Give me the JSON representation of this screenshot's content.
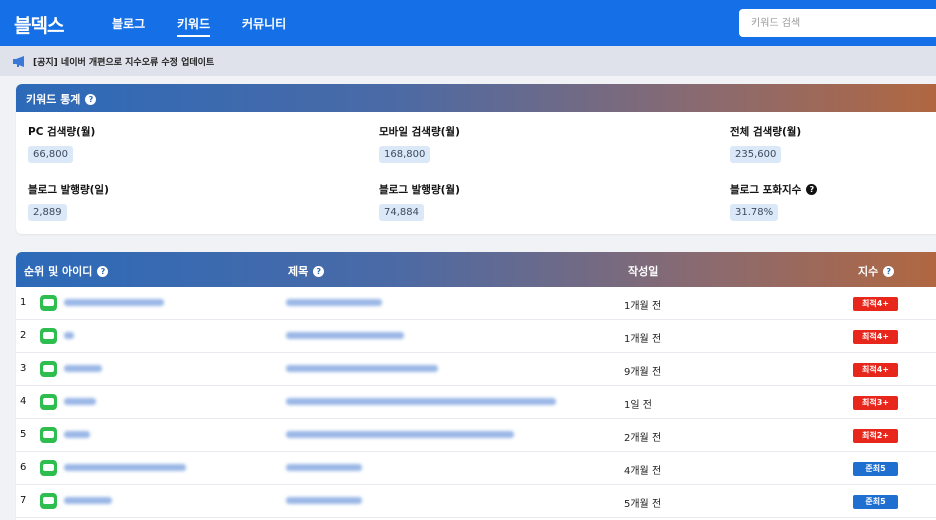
{
  "app": {
    "logo": "블덱스"
  },
  "nav": [
    {
      "label": "블로그"
    },
    {
      "label": "키워드"
    },
    {
      "label": "커뮤니티"
    }
  ],
  "search": {
    "placeholder": "키워드 검색"
  },
  "notice": {
    "text": "[공지] 네이버 개편으로 지수오류 수정 업데이트"
  },
  "stats": {
    "title": "키워드 통계",
    "items": [
      {
        "label": "PC 검색량(월)",
        "value": "66,800"
      },
      {
        "label": "모바일 검색량(월)",
        "value": "168,800"
      },
      {
        "label": "전체 검색량(월)",
        "value": "235,600"
      },
      {
        "label": "블로그 발행량(일)",
        "value": "2,889"
      },
      {
        "label": "블로그 발행량(월)",
        "value": "74,884"
      },
      {
        "label": "블로그 포화지수",
        "value": "31.78%"
      }
    ]
  },
  "table": {
    "headers": {
      "rank": "순위 및 아이디",
      "title": "제목",
      "date": "작성일",
      "index": "지수"
    },
    "rows": [
      {
        "rank": "1",
        "date": "1개월 전",
        "badge": "최적4+",
        "badge_color": "#e8271c"
      },
      {
        "rank": "2",
        "date": "1개월 전",
        "badge": "최적4+",
        "badge_color": "#e8271c"
      },
      {
        "rank": "3",
        "date": "9개월 전",
        "badge": "최적4+",
        "badge_color": "#e8271c"
      },
      {
        "rank": "4",
        "date": "1일 전",
        "badge": "최적3+",
        "badge_color": "#e8271c"
      },
      {
        "rank": "5",
        "date": "2개월 전",
        "badge": "최적2+",
        "badge_color": "#e8271c"
      },
      {
        "rank": "6",
        "date": "4개월 전",
        "badge": "준최5",
        "badge_color": "#1f6fd0"
      },
      {
        "rank": "7",
        "date": "5개월 전",
        "badge": "준최5",
        "badge_color": "#1f6fd0"
      }
    ]
  },
  "colors": {
    "brand": "#1570e8",
    "badge_red": "#e8271c",
    "badge_blue": "#1f6fd0",
    "blog_green": "#2dbe4f"
  }
}
